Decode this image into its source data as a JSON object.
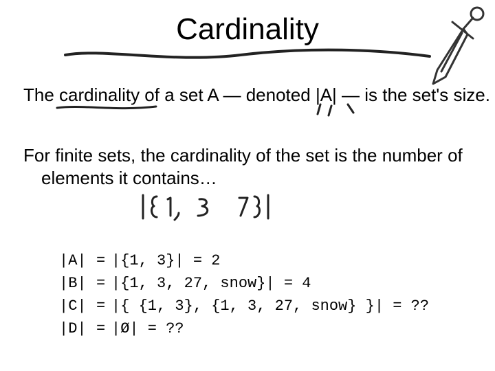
{
  "title": "Cardinality",
  "para1_a": "The cardinality of a set A — denoted",
  "para1_b": "|A|",
  "para1_c": "— is the set's size.",
  "para2": "For finite sets, the cardinality of the set is the number of elements it contains…",
  "code": {
    "r1_lhs": "|A|",
    "r1_eq": "=",
    "r1_rhs": "|{1, 3}| = 2",
    "r2_lhs": "|B|",
    "r2_eq": "=",
    "r2_rhs": "|{1, 3, 27, snow}| = 4",
    "r3_lhs": "|C|",
    "r3_eq": "=",
    "r3_rhs": "|{ {1, 3}, {1, 3, 27, snow} }| = ??",
    "r4_lhs": "|D|",
    "r4_eq": "=",
    "r4_rhs": "|Ø| = ??"
  },
  "annotation": "|{1, 3 }|",
  "icons": {
    "sword": "sword-icon"
  }
}
